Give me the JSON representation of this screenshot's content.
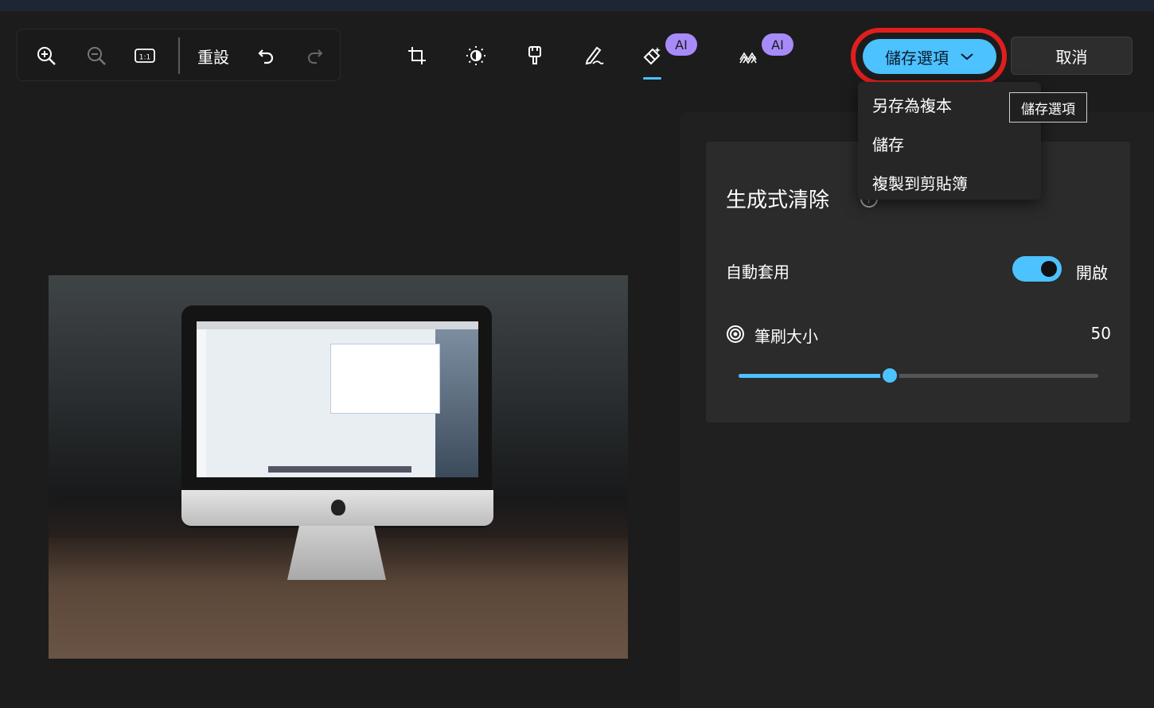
{
  "toolbar": {
    "reset_label": "重設",
    "ai_badge": "AI"
  },
  "save": {
    "label": "儲存選項",
    "tooltip": "儲存選項",
    "menu": [
      "另存為複本",
      "儲存",
      "複製到剪貼簿"
    ]
  },
  "cancel": {
    "label": "取消"
  },
  "panel": {
    "title": "生成式清除",
    "auto_apply": {
      "label": "自動套用",
      "state": "開啟"
    },
    "brush": {
      "label": "筆刷大小",
      "value": "50",
      "fraction": 0.42
    }
  },
  "colors": {
    "accent": "#4cc2ff",
    "highlight_ring": "#e01e1e",
    "ai_badge": "#a78bfa"
  },
  "icons": {
    "zoom_in": "zoom-in-icon",
    "zoom_out": "zoom-out-icon",
    "actual_size": "actual-size-icon",
    "undo": "undo-icon",
    "redo": "redo-icon",
    "crop": "crop-icon",
    "adjust": "brightness-icon",
    "filter": "filter-icon",
    "markup": "markup-icon",
    "erase": "generative-erase-icon",
    "blur": "background-blur-icon"
  }
}
